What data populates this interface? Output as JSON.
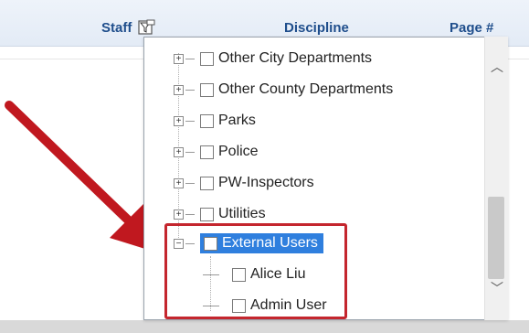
{
  "header": {
    "columns": [
      "Staff",
      "Discipline",
      "Page #"
    ]
  },
  "tree": {
    "items": [
      {
        "label": "Other City Departments",
        "checked": false
      },
      {
        "label": "Other County Departments",
        "checked": false
      },
      {
        "label": "Parks",
        "checked": false
      },
      {
        "label": "Police",
        "checked": false
      },
      {
        "label": "PW-Inspectors",
        "checked": false
      },
      {
        "label": "Utilities",
        "checked": false
      },
      {
        "label": "External Users",
        "checked": false,
        "expanded": true,
        "selected": true,
        "children": [
          {
            "label": "Alice Liu",
            "checked": false
          },
          {
            "label": "Admin User",
            "checked": false
          }
        ]
      }
    ]
  },
  "colors": {
    "header_text": "#1f4e8c",
    "selected_bg": "#2f7fde",
    "highlight_red": "#c4262e",
    "arrow_red": "#c0181f"
  },
  "icons": {
    "filter": "filter-icon",
    "scroll_up": "chevron-up-icon",
    "scroll_down": "chevron-down-icon",
    "expand": "plus-square-icon",
    "collapse": "minus-square-icon"
  }
}
